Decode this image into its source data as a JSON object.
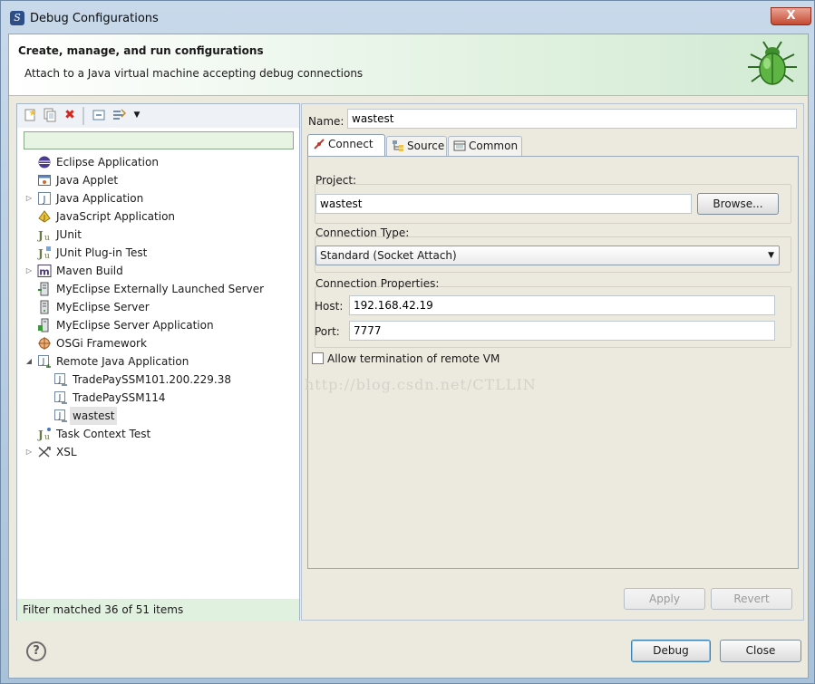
{
  "window": {
    "title": "Debug Configurations",
    "close_symbol": "X"
  },
  "banner": {
    "title": "Create, manage, and run configurations",
    "message": "Attach to a Java virtual machine accepting debug connections",
    "icon": "bug-icon"
  },
  "left_toolbar": {
    "icons": [
      "new-configuration-icon",
      "duplicate-icon",
      "delete-icon",
      "collapse-all-icon",
      "filter-icon",
      "dropdown-icon"
    ]
  },
  "filter": {
    "value": ""
  },
  "tree": {
    "items": [
      {
        "label": "Eclipse Application",
        "icon": "eclipse-icon",
        "depth": 0,
        "expander": "",
        "selected": false
      },
      {
        "label": "Java Applet",
        "icon": "applet-icon",
        "depth": 0,
        "expander": "",
        "selected": false
      },
      {
        "label": "Java Application",
        "icon": "java-app-icon",
        "depth": 0,
        "expander": "collapsed",
        "selected": false
      },
      {
        "label": "JavaScript Application",
        "icon": "javascript-icon",
        "depth": 0,
        "expander": "",
        "selected": false
      },
      {
        "label": "JUnit",
        "icon": "junit-icon",
        "depth": 0,
        "expander": "",
        "selected": false
      },
      {
        "label": "JUnit Plug-in Test",
        "icon": "junit-plugin-icon",
        "depth": 0,
        "expander": "",
        "selected": false
      },
      {
        "label": "Maven Build",
        "icon": "maven-icon",
        "depth": 0,
        "expander": "collapsed",
        "selected": false
      },
      {
        "label": "MyEclipse Externally Launched Server",
        "icon": "external-server-icon",
        "depth": 0,
        "expander": "",
        "selected": false
      },
      {
        "label": "MyEclipse Server",
        "icon": "server-icon",
        "depth": 0,
        "expander": "",
        "selected": false
      },
      {
        "label": "MyEclipse Server Application",
        "icon": "server-app-icon",
        "depth": 0,
        "expander": "",
        "selected": false
      },
      {
        "label": "OSGi Framework",
        "icon": "osgi-icon",
        "depth": 0,
        "expander": "",
        "selected": false
      },
      {
        "label": "Remote Java Application",
        "icon": "remote-java-icon",
        "depth": 0,
        "expander": "expanded",
        "selected": false
      },
      {
        "label": "TradePaySSM101.200.229.38",
        "icon": "remote-config-icon",
        "depth": 1,
        "expander": "",
        "selected": false
      },
      {
        "label": "TradePaySSM114",
        "icon": "remote-config-icon",
        "depth": 1,
        "expander": "",
        "selected": false
      },
      {
        "label": "wastest",
        "icon": "remote-config-icon",
        "depth": 1,
        "expander": "",
        "selected": true
      },
      {
        "label": "Task Context Test",
        "icon": "task-context-icon",
        "depth": 0,
        "expander": "",
        "selected": false
      },
      {
        "label": "XSL",
        "icon": "xsl-icon",
        "depth": 0,
        "expander": "collapsed",
        "selected": false
      }
    ]
  },
  "filter_status": "Filter matched 36 of 51 items",
  "config": {
    "name_label": "Name:",
    "name_value": "wastest",
    "tabs": [
      {
        "label": "Connect",
        "icon": "connect-icon",
        "active": true
      },
      {
        "label": "Source",
        "icon": "source-icon",
        "active": false
      },
      {
        "label": "Common",
        "icon": "common-icon",
        "active": false
      }
    ],
    "project": {
      "title": "Project:",
      "value": "wastest",
      "browse_label": "Browse..."
    },
    "connection_type": {
      "title": "Connection Type:",
      "value": "Standard (Socket Attach)"
    },
    "connection_properties": {
      "title": "Connection Properties:",
      "host_label": "Host:",
      "host_value": "192.168.42.19",
      "port_label": "Port:",
      "port_value": "7777"
    },
    "allow_termination": {
      "label": "Allow termination of remote VM",
      "checked": false
    },
    "apply_label": "Apply",
    "revert_label": "Revert"
  },
  "watermark": "http://blog.csdn.net/CTLLIN",
  "footer": {
    "help_symbol": "?",
    "debug_label": "Debug",
    "close_label": "Close"
  }
}
